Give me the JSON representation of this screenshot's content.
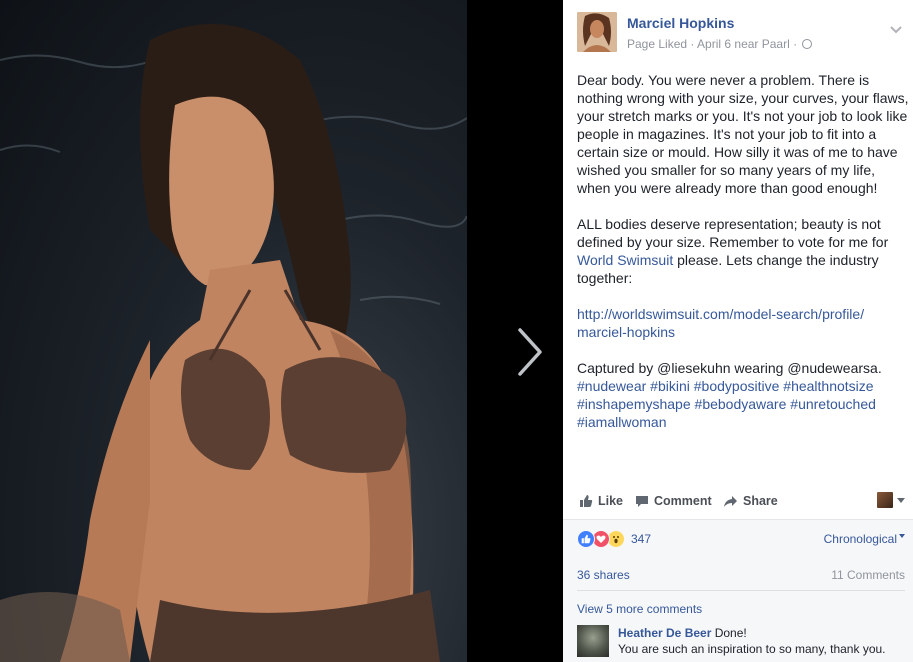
{
  "post": {
    "author": "Marciel Hopkins",
    "meta": "Page Liked · April 6 near Paarl ·",
    "privacy_icon": "globe-icon",
    "body": {
      "p1": "Dear body. You were never a problem. There is nothing wrong with your size, your curves, your flaws, your stretch marks or you. It's not your job to look like people in magazines. It's not your job to fit into a certain size or mould. How silly it was of me to have wished you smaller for so many years of my life, when you were already more than good enough!",
      "p2_before": "ALL bodies deserve representation; beauty is not defined by your size. Remember to vote for me for ",
      "p2_link": "World Swimsuit",
      "p2_after": " please. Lets change the industry together:",
      "url_line1": "http://worldswimsuit.com/model-search/profile/",
      "url_line2": "marciel-hopkins",
      "p4_text": "Captured by @liesekuhn wearing @nudewearsa.",
      "hashtags": [
        "#nudewear",
        "#bikini",
        "#bodypositive",
        "#healthnotsize",
        "#inshapemyshape",
        "#bebodyaware",
        "#unretouched",
        "#iamallwoman"
      ]
    }
  },
  "actions": {
    "like": "Like",
    "comment": "Comment",
    "share": "Share"
  },
  "feedback": {
    "reaction_count": "347",
    "sort_label": "Chronological",
    "shares": "36 shares",
    "comments": "11 Comments",
    "view_more": "View 5 more comments"
  },
  "comment": {
    "name": "Heather De Beer",
    "line1": "Done!",
    "line2": "You are such an inspiration to so many, thank you."
  },
  "colors": {
    "link": "#365899",
    "text": "#1d2129",
    "meta": "#90949c",
    "like_reaction": "#4080ff",
    "love_reaction": "#f25268",
    "wow_reaction": "#fcd75c"
  }
}
